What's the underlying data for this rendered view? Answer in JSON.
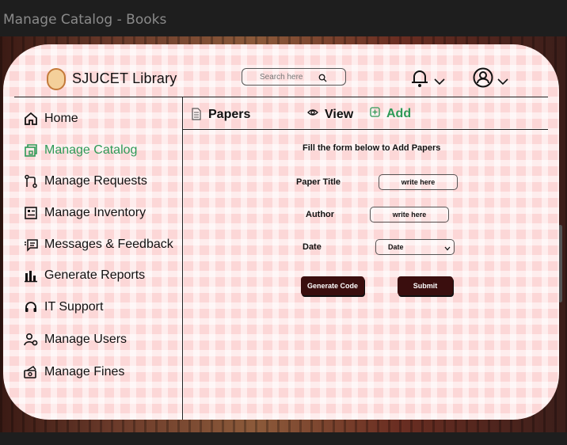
{
  "window": {
    "title": "Manage Catalog - Books"
  },
  "header": {
    "library_name": "SJUCET  Library",
    "search_placeholder": "Search here"
  },
  "sidebar": {
    "items": [
      {
        "label": "Home",
        "icon": "home-icon"
      },
      {
        "label": "Manage Catalog",
        "icon": "catalog-icon",
        "active": true
      },
      {
        "label": "Manage Requests",
        "icon": "requests-icon"
      },
      {
        "label": "Manage Inventory",
        "icon": "inventory-icon"
      },
      {
        "label": "Messages & Feedback",
        "icon": "messages-icon"
      },
      {
        "label": "Generate Reports",
        "icon": "reports-icon"
      },
      {
        "label": "IT Support",
        "icon": "headset-icon"
      },
      {
        "label": "Manage Users",
        "icon": "users-icon"
      },
      {
        "label": "Manage Fines",
        "icon": "fines-icon"
      }
    ]
  },
  "content": {
    "section_title": "Papers",
    "view_label": "View",
    "add_label": "Add",
    "form_heading": "Fill the form below to Add Papers",
    "paper_title_label": "Paper Title",
    "paper_title_value": "write here",
    "author_label": "Author",
    "author_value": "write here",
    "date_label": "Date",
    "date_value": "Date",
    "generate_code_label": "Generate Code",
    "submit_label": "Submit"
  },
  "colors": {
    "accent": "#2e9a57",
    "dark_button": "#3a0e0e",
    "card": "#fcd7d7"
  }
}
